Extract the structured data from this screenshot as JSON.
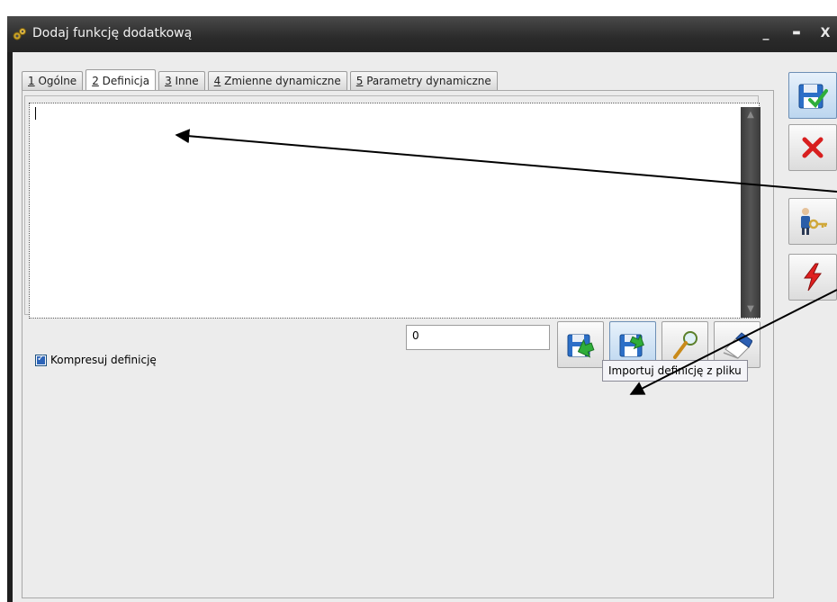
{
  "window": {
    "title": "Dodaj funkcję dodatkową",
    "minimize_glyph": "_",
    "maximize_glyph": "▬",
    "close_glyph": "X"
  },
  "tabs": [
    {
      "key": "1",
      "label": " Ogólne"
    },
    {
      "key": "2",
      "label": " Definicja"
    },
    {
      "key": "3",
      "label": " Inne"
    },
    {
      "key": "4",
      "label": " Zmienne dynamiczne"
    },
    {
      "key": "5",
      "label": " Parametry dynamiczne"
    }
  ],
  "active_tab": "2 Definicja",
  "editor": {
    "value": ""
  },
  "counter": {
    "value": "0"
  },
  "checkbox": {
    "label": "Kompresuj definicję",
    "checked": true
  },
  "tooltip": {
    "text": "Importuj definicję z pliku"
  },
  "definition_buttons": [
    {
      "icon": "floppy-export-icon"
    },
    {
      "icon": "floppy-import-icon"
    },
    {
      "icon": "magnifier-icon"
    },
    {
      "icon": "eraser-icon"
    }
  ],
  "side_buttons": [
    {
      "icon": "save-check-icon"
    },
    {
      "icon": "cancel-x-icon"
    },
    {
      "icon": "user-key-icon"
    },
    {
      "icon": "lightning-icon"
    }
  ],
  "colors": {
    "titlebar": "#2b2b2b",
    "background": "#ececec",
    "accent_blue": "#2d64b8",
    "cancel_red": "#d81f1f"
  }
}
